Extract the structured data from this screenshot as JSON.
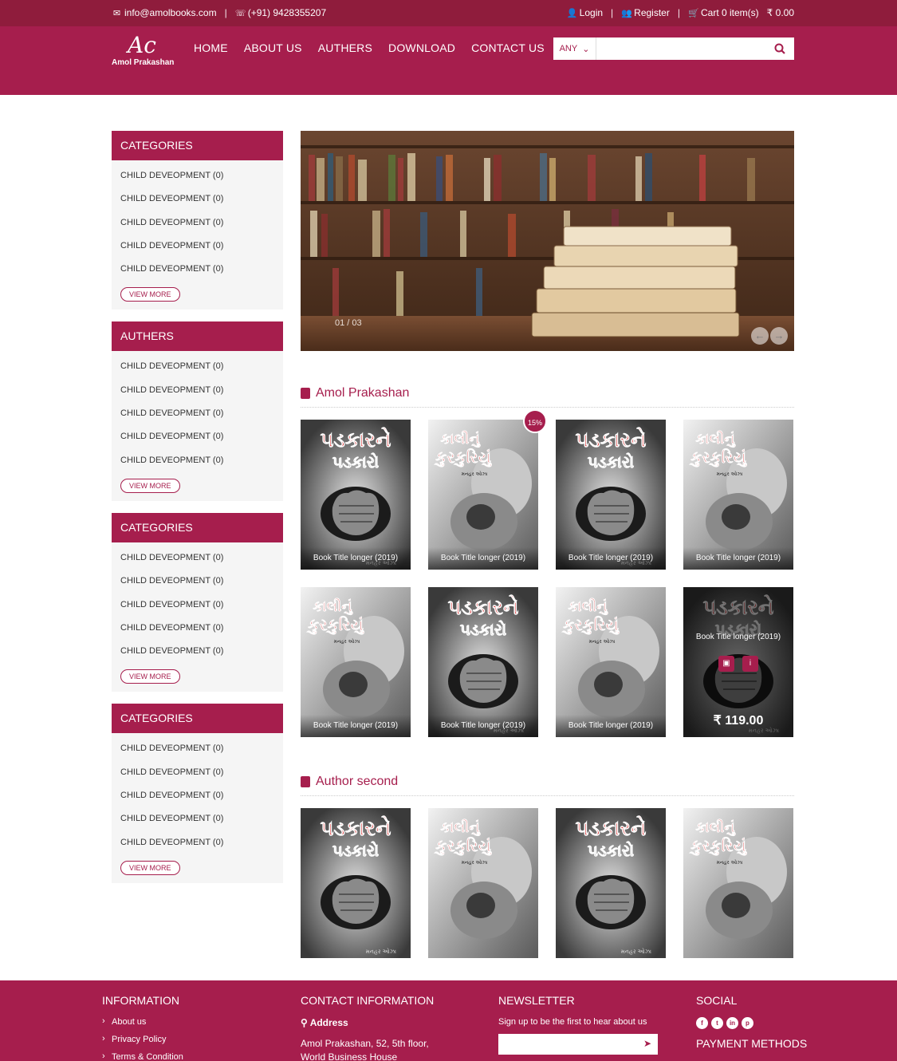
{
  "topbar": {
    "email": "info@amolbooks.com",
    "phone": "(+91) 9428355207",
    "login": "Login",
    "register": "Register",
    "cart": "Cart 0 item(s)",
    "cart_total": "₹ 0.00",
    "separator": "|"
  },
  "header": {
    "logo_name": "Amol Prakashan",
    "logo_mark": "Ac",
    "nav": [
      "HOME",
      "ABOUT US",
      "AUTHERS",
      "DOWNLOAD",
      "CONTACT US"
    ],
    "search_select": "ANY",
    "search_placeholder": ""
  },
  "sidebar": [
    {
      "title": "CATEGORIES",
      "items": [
        "CHILD DEVEOPMENT (0)",
        "CHILD DEVEOPMENT (0)",
        "CHILD DEVEOPMENT (0)",
        "CHILD DEVEOPMENT (0)",
        "CHILD DEVEOPMENT (0)"
      ],
      "view_more": "VIEW MORE"
    },
    {
      "title": "AUTHERS",
      "items": [
        "CHILD DEVEOPMENT (0)",
        "CHILD DEVEOPMENT (0)",
        "CHILD DEVEOPMENT (0)",
        "CHILD DEVEOPMENT (0)",
        "CHILD DEVEOPMENT (0)"
      ],
      "view_more": "VIEW MORE"
    },
    {
      "title": "CATEGORIES",
      "items": [
        "CHILD DEVEOPMENT (0)",
        "CHILD DEVEOPMENT (0)",
        "CHILD DEVEOPMENT (0)",
        "CHILD DEVEOPMENT (0)",
        "CHILD DEVEOPMENT (0)"
      ],
      "view_more": "VIEW MORE"
    },
    {
      "title": "CATEGORIES",
      "items": [
        "CHILD DEVEOPMENT (0)",
        "CHILD DEVEOPMENT (0)",
        "CHILD DEVEOPMENT (0)",
        "CHILD DEVEOPMENT (0)",
        "CHILD DEVEOPMENT (0)"
      ],
      "view_more": "VIEW MORE"
    }
  ],
  "slider": {
    "counter": "01 / 03"
  },
  "sections": {
    "first": {
      "title": "Amol Prakashan",
      "badge": "15%",
      "hover_price": "₹ 119.00",
      "books": [
        {
          "cover": "fist",
          "caption": "Book Title longer (2019)"
        },
        {
          "cover": "child",
          "caption": "Book Title longer (2019)"
        },
        {
          "cover": "fist",
          "caption": "Book Title longer (2019)"
        },
        {
          "cover": "child",
          "caption": "Book Title longer (2019)"
        },
        {
          "cover": "child",
          "caption": "Book Title longer (2019)"
        },
        {
          "cover": "fist",
          "caption": "Book Title longer (2019)"
        },
        {
          "cover": "child",
          "caption": "Book Title longer (2019)"
        },
        {
          "cover": "fist",
          "caption": "Book Title longer (2019)"
        }
      ]
    },
    "second": {
      "title": "Author second",
      "books": [
        {
          "cover": "fist",
          "caption": ""
        },
        {
          "cover": "child",
          "caption": ""
        },
        {
          "cover": "fist",
          "caption": ""
        },
        {
          "cover": "child",
          "caption": ""
        }
      ]
    }
  },
  "cover_titles": {
    "fist_line1": "પડકારને",
    "fist_line2": "પડકારો",
    "child_line1": "કાલીનું",
    "child_line2": "કુરકુરિયું",
    "author": "મનહર ઓઝા"
  },
  "footer": {
    "information": {
      "title": "INFORMATION",
      "links": [
        "About us",
        "Privacy Policy",
        "Terms & Condition"
      ]
    },
    "contact": {
      "title": "CONTACT INFORMATION",
      "address_label": "Address",
      "address_line1": "Amol Prakashan, 52, 5th floor,",
      "address_line2": "World Business House"
    },
    "newsletter": {
      "title": "NEWSLETTER",
      "text": "Sign up to be the first to hear about us"
    },
    "social": {
      "title": "SOCIAL",
      "icons": [
        "facebook-icon",
        "twitter-icon",
        "linkedin-icon",
        "pinterest-icon"
      ],
      "payment_title": "PAYMENT METHODS"
    }
  },
  "colors": {
    "primary": "#a61e4d",
    "topbar": "#8f1c3c",
    "sidebar_bg": "#f5f5f5"
  }
}
